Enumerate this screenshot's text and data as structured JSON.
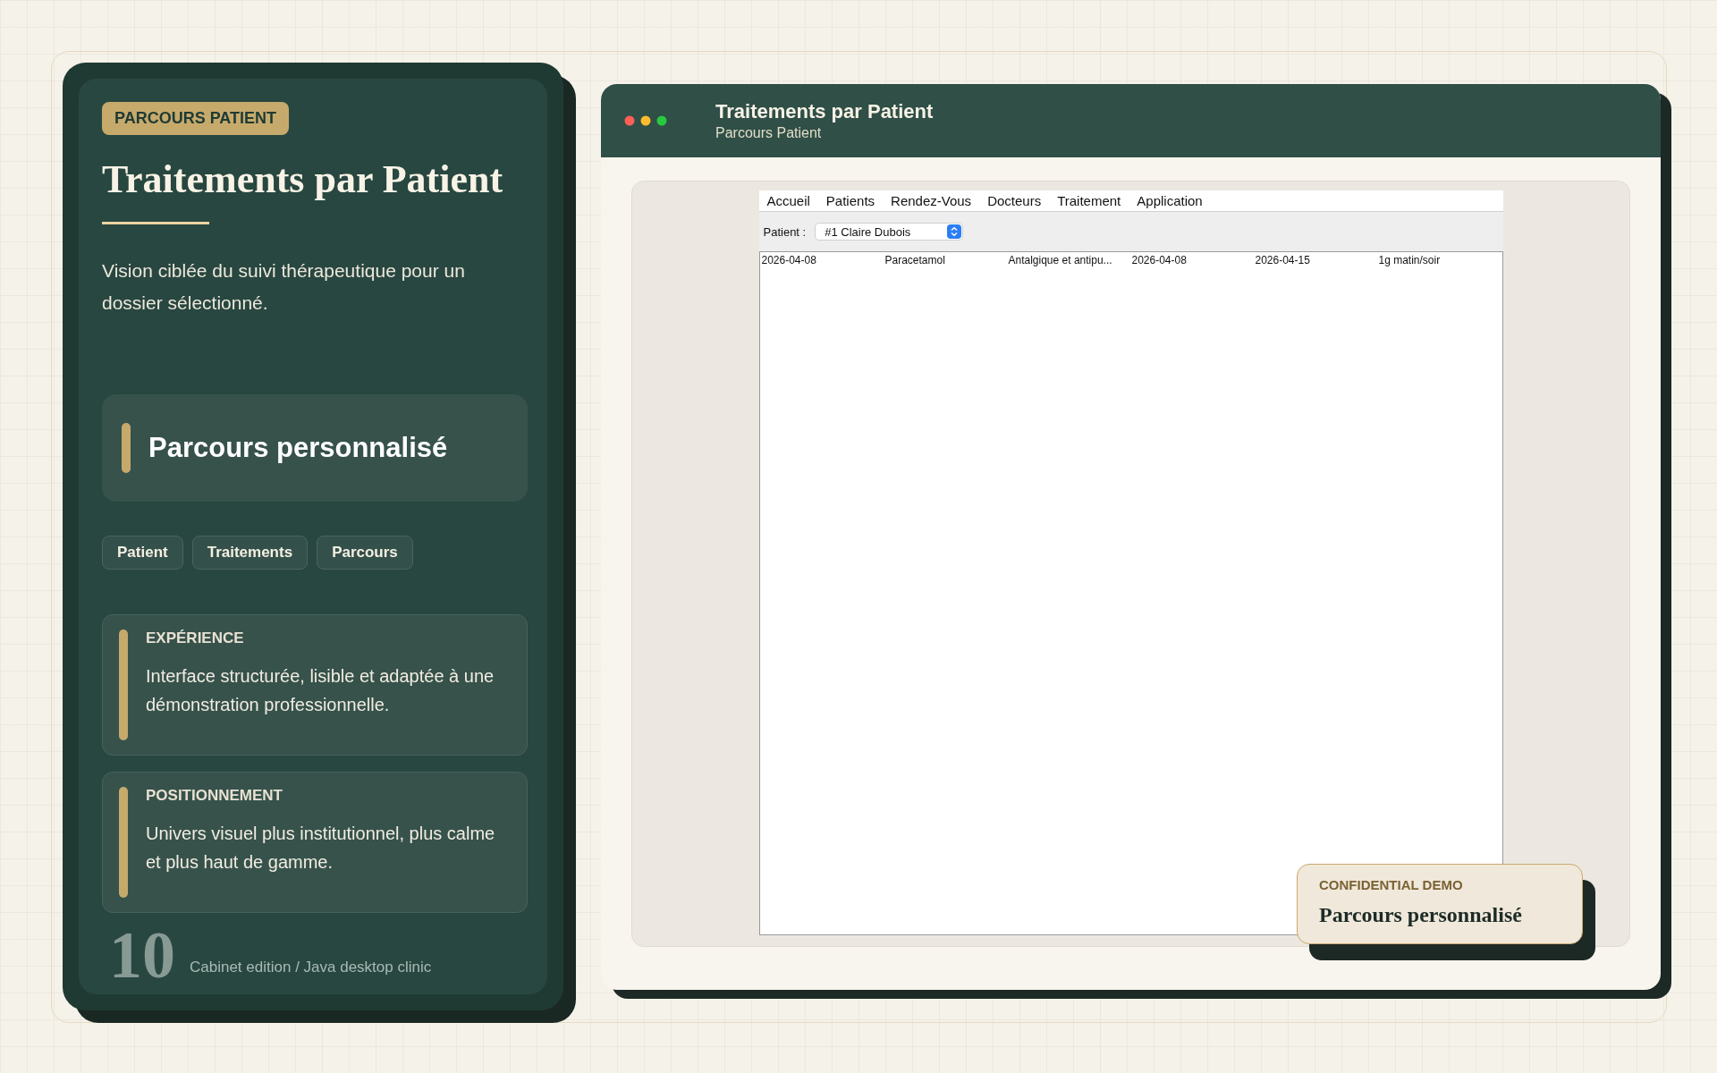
{
  "panel": {
    "badge": "PARCOURS PATIENT",
    "title": "Traitements par Patient",
    "description": "Vision ciblée du suivi thérapeutique pour un dossier sélectionné.",
    "highlight": "Parcours personnalisé",
    "tags": [
      "Patient",
      "Traitements",
      "Parcours"
    ],
    "cards": [
      {
        "label": "EXPÉRIENCE",
        "text": "Interface structurée, lisible et adaptée à une démonstration professionnelle."
      },
      {
        "label": "POSITIONNEMENT",
        "text": "Univers visuel plus institutionnel, plus calme et plus haut de gamme."
      }
    ],
    "page_number": "10",
    "footer": "Cabinet edition / Java desktop clinic"
  },
  "window": {
    "title": "Traitements par Patient",
    "subtitle": "Parcours Patient",
    "app": {
      "menu": [
        "Accueil",
        "Patients",
        "Rendez-Vous",
        "Docteurs",
        "Traitement",
        "Application"
      ],
      "filter": {
        "label": "Patient :",
        "value": "#1 Claire Dubois"
      },
      "rows": [
        {
          "cells": [
            "2026-04-08",
            "Paracetamol",
            "Antalgique et antipu...",
            "2026-04-08",
            "2026-04-15",
            "1g matin/soir"
          ]
        }
      ]
    }
  },
  "stamp": {
    "label": "CONFIDENTIAL DEMO",
    "title": "Parcours personnalisé"
  }
}
